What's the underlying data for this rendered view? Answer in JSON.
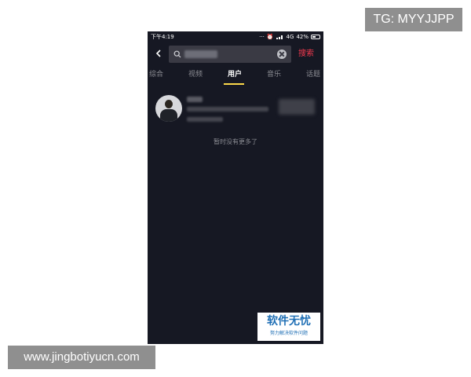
{
  "badges": {
    "telegram": "TG: MYYJJPP",
    "website": "www.jingbotiyucn.com"
  },
  "status_bar": {
    "time": "下午4:19",
    "network": "4G",
    "battery": "42%",
    "icons": [
      "dots-icon",
      "alarm-icon",
      "signal-icon",
      "battery-icon"
    ]
  },
  "search": {
    "query_blurred": true,
    "button_label": "搜索"
  },
  "tabs": [
    {
      "label": "综合",
      "active": false
    },
    {
      "label": "视频",
      "active": false
    },
    {
      "label": "用户",
      "active": true
    },
    {
      "label": "音乐",
      "active": false
    },
    {
      "label": "话题",
      "active": false
    }
  ],
  "result": {
    "user_blurred": true
  },
  "no_more_text": "暂时没有更多了",
  "watermark": {
    "title": "软件无忧",
    "subtitle": "努力解决软件问题"
  },
  "colors": {
    "app_background": "#161823",
    "accent_red": "#f53a4f",
    "tab_indicator": "#fbd84a",
    "watermark_blue": "#1f6fb5"
  }
}
